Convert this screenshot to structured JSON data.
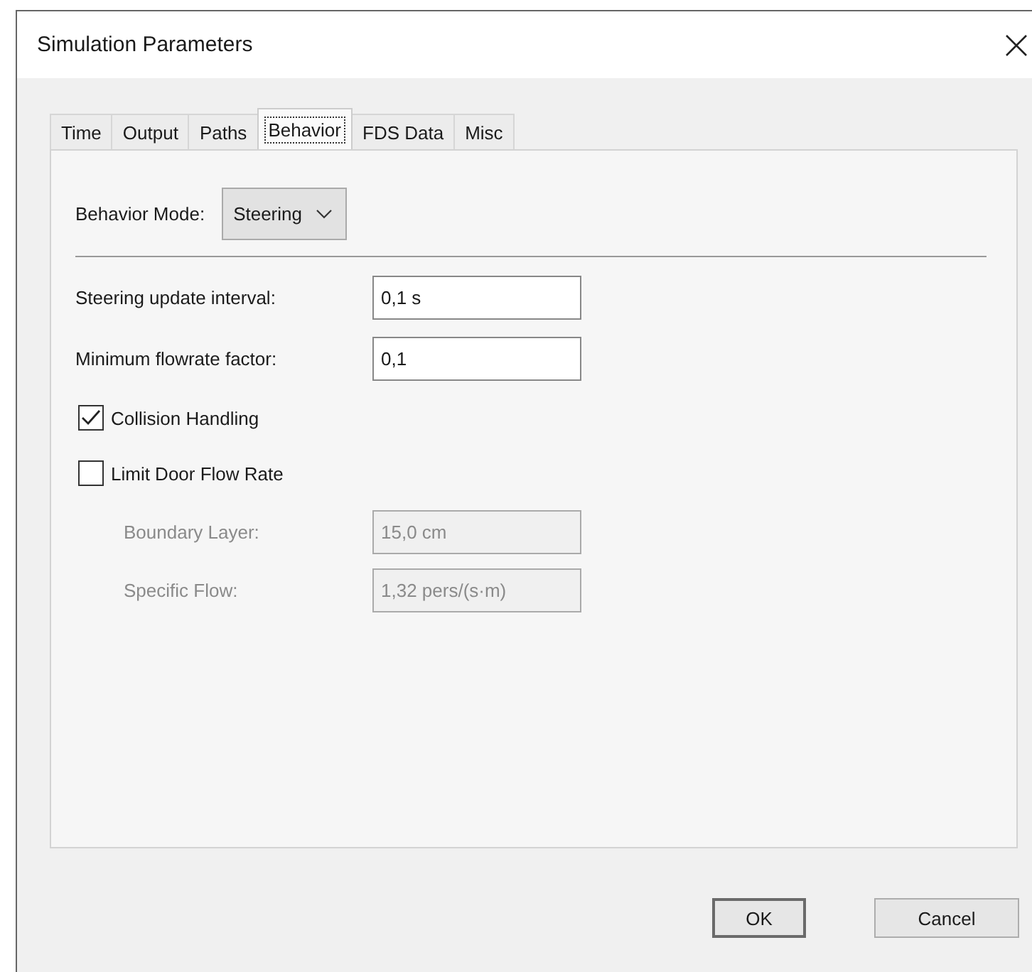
{
  "window": {
    "title": "Simulation Parameters"
  },
  "tabs": [
    {
      "label": "Time",
      "selected": false
    },
    {
      "label": "Output",
      "selected": false
    },
    {
      "label": "Paths",
      "selected": false
    },
    {
      "label": "Behavior",
      "selected": true
    },
    {
      "label": "FDS Data",
      "selected": false
    },
    {
      "label": "Misc",
      "selected": false
    }
  ],
  "behavior_mode": {
    "label": "Behavior Mode:",
    "value": "Steering"
  },
  "rows": [
    {
      "kind": "field",
      "label": "Steering update interval:",
      "value": "0,1 s",
      "disabled": false
    },
    {
      "kind": "field",
      "label": "Minimum flowrate factor:",
      "value": "0,1",
      "disabled": false
    },
    {
      "kind": "checkbox",
      "label": "Collision Handling",
      "checked": true
    },
    {
      "kind": "checkbox",
      "label": "Limit Door Flow Rate",
      "checked": false,
      "children": [
        {
          "label": "Boundary Layer:",
          "value": "15,0 cm",
          "disabled": true
        },
        {
          "label": "Specific Flow:",
          "value": "1,32 pers/(s·m)",
          "disabled": true
        }
      ]
    }
  ],
  "buttons": [
    {
      "label": "OK",
      "default": true
    },
    {
      "label": "Cancel",
      "default": false
    }
  ]
}
